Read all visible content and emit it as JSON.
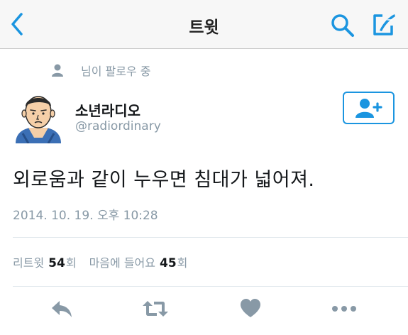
{
  "nav": {
    "title": "트윗",
    "back_icon": "chevron-left-icon",
    "search_icon": "search-icon",
    "compose_icon": "compose-icon",
    "accent_color": "#1b95e0"
  },
  "context": {
    "text": "님이 팔로우 중",
    "icon": "person-icon"
  },
  "tweet": {
    "author_name": "소년라디오",
    "author_handle": "@radiordinary",
    "text": "외로움과 같이 누우면 침대가 넓어져.",
    "timestamp": "2014. 10. 19. 오후 10:28",
    "follow_button_icon": "follow-user-icon"
  },
  "stats": {
    "retweets_label": "리트윗",
    "retweets_count": "54",
    "retweets_unit": "회",
    "likes_label": "마음에 들어요",
    "likes_count": "45",
    "likes_unit": "회"
  },
  "actions": {
    "reply_icon": "reply-icon",
    "retweet_icon": "retweet-icon",
    "like_icon": "heart-icon",
    "more_icon": "more-icon"
  }
}
